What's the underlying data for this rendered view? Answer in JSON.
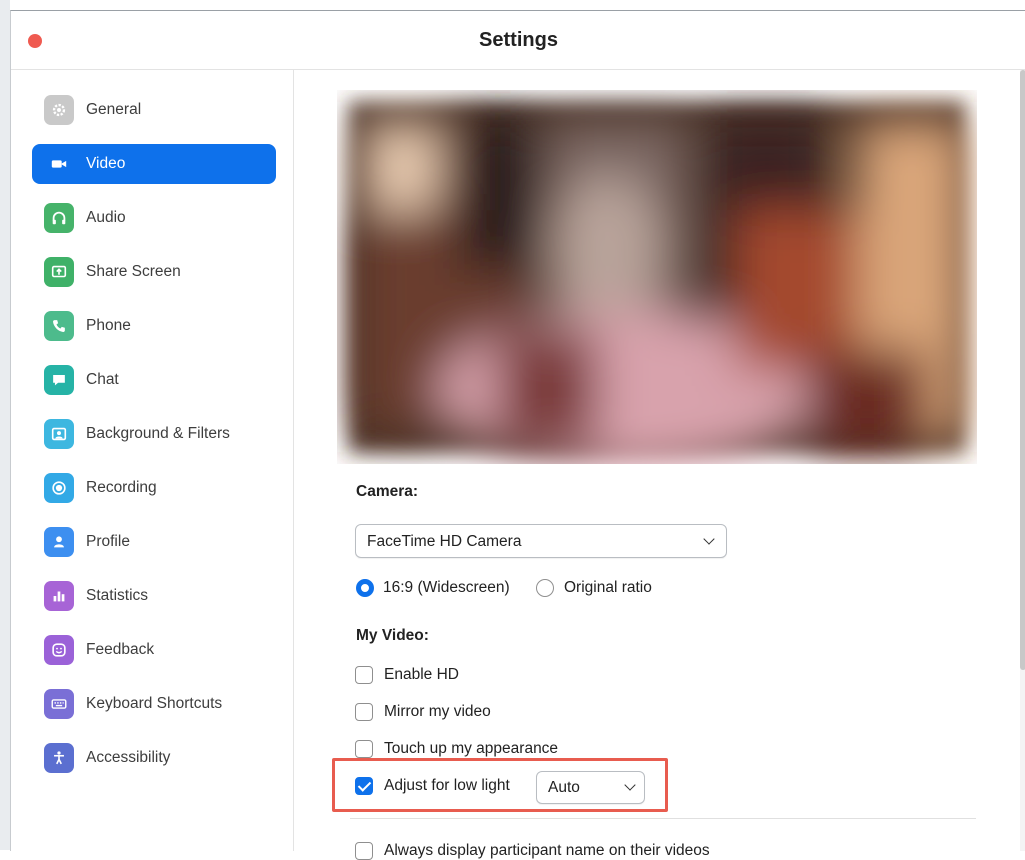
{
  "window": {
    "title": "Settings"
  },
  "sidebar": {
    "items": [
      {
        "label": "General",
        "icon": "gear-icon",
        "color": "#c9c9c9"
      },
      {
        "label": "Video",
        "icon": "video-camera-icon",
        "color": "#0e71eb"
      },
      {
        "label": "Audio",
        "icon": "headphones-icon",
        "color": "#46b36a"
      },
      {
        "label": "Share Screen",
        "icon": "share-screen-icon",
        "color": "#3fb168"
      },
      {
        "label": "Phone",
        "icon": "phone-icon",
        "color": "#4dbb8c"
      },
      {
        "label": "Chat",
        "icon": "chat-icon",
        "color": "#26b3a6"
      },
      {
        "label": "Background & Filters",
        "icon": "background-icon",
        "color": "#3db7e0"
      },
      {
        "label": "Recording",
        "icon": "record-icon",
        "color": "#32a9e6"
      },
      {
        "label": "Profile",
        "icon": "person-icon",
        "color": "#3d8ff0"
      },
      {
        "label": "Statistics",
        "icon": "bar-chart-icon",
        "color": "#a764d6"
      },
      {
        "label": "Feedback",
        "icon": "smiley-icon",
        "color": "#9b62d8"
      },
      {
        "label": "Keyboard Shortcuts",
        "icon": "keyboard-icon",
        "color": "#7a6fd6"
      },
      {
        "label": "Accessibility",
        "icon": "accessibility-icon",
        "color": "#5b6fd0"
      }
    ],
    "active_index": 1
  },
  "video": {
    "camera_label": "Camera:",
    "camera_value": "FaceTime HD Camera",
    "ratio_widescreen": "16:9 (Widescreen)",
    "ratio_original": "Original ratio",
    "my_video_label": "My Video:",
    "enable_hd": "Enable HD",
    "mirror": "Mirror my video",
    "touch_up": "Touch up my appearance",
    "low_light": "Adjust for low light",
    "low_light_mode": "Auto",
    "always_display_names": "Always display participant name on their videos"
  },
  "colors": {
    "accent": "#0e71eb",
    "highlight": "#e85c4f",
    "close_button": "#ef5a50"
  }
}
